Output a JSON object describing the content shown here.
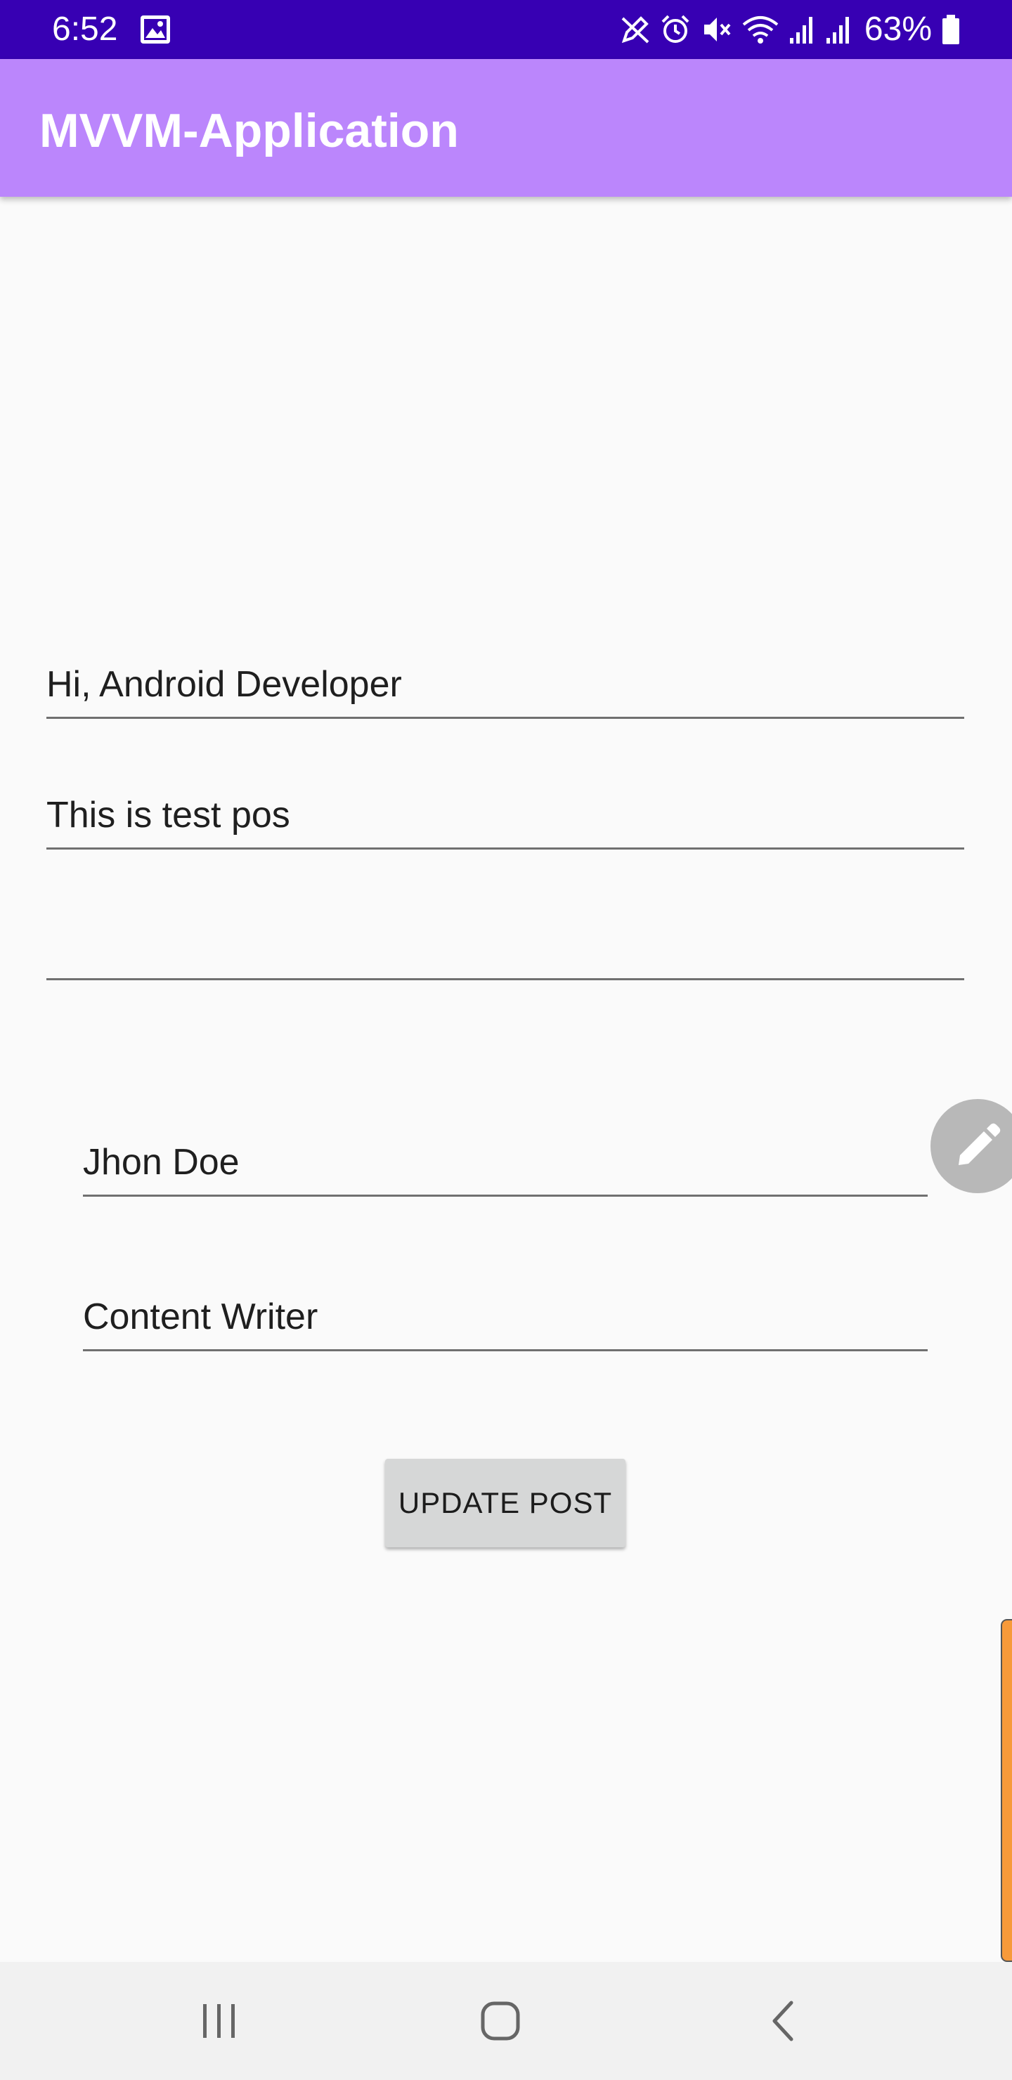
{
  "status_bar": {
    "time": "6:52",
    "battery": "63%",
    "icons": [
      "image-icon",
      "pen-icon",
      "alarm-icon",
      "mute-icon",
      "wifi-icon",
      "signal-icon",
      "signal-icon",
      "battery-icon"
    ]
  },
  "app_bar": {
    "title": "MVVM-Application"
  },
  "form": {
    "title_value": "Hi, Android Developer",
    "body_value": "This is test pos",
    "empty_value": "",
    "author_value": "Jhon Doe",
    "role_value": "Content Writer",
    "update_button": "UPDATE POST"
  },
  "fab": {
    "icon": "pencil-icon"
  },
  "nav_bar": {
    "icons": [
      "recents-icon",
      "home-icon",
      "back-icon"
    ]
  },
  "colors": {
    "status_bar": "#3700b3",
    "app_bar": "#bb86fc",
    "background": "#fafafa",
    "button": "#d6d7d7",
    "fab": "#b8b8b8",
    "scroll_indicator": "#f79a3a"
  }
}
